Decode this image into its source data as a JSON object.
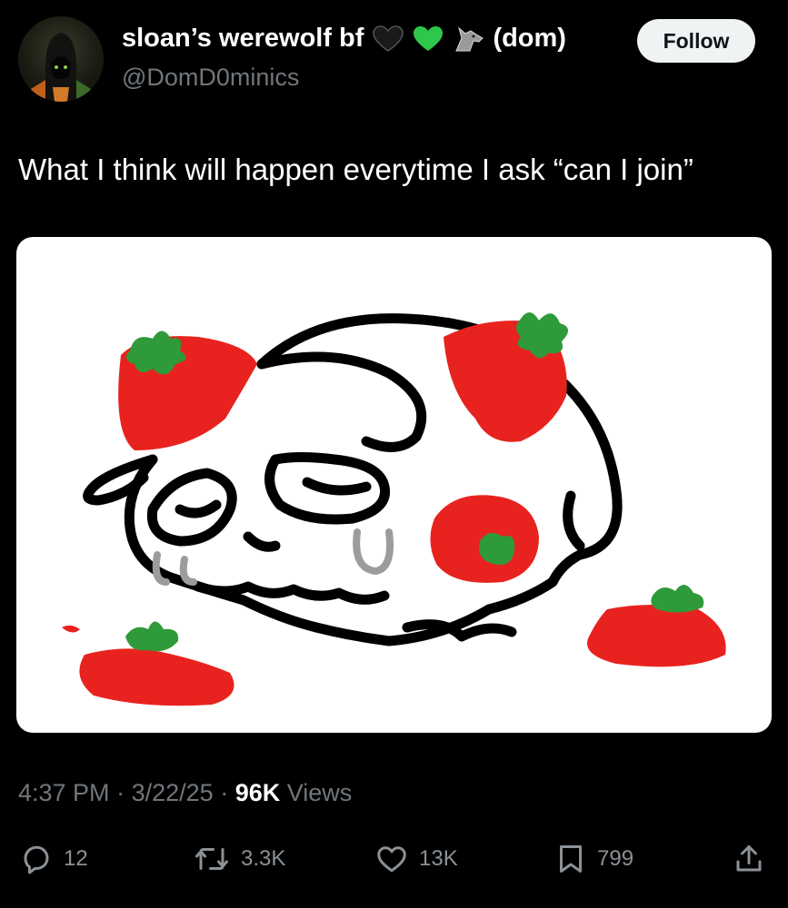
{
  "tweet": {
    "display_name": "sloan’s werewolf bf",
    "name_suffix": "(dom)",
    "handle": "@DomD0minics",
    "follow_label": "Follow",
    "text": "What I think will happen everytime I ask “can I join”",
    "time": "4:37 PM",
    "date": "3/22/25",
    "views_count": "96K",
    "views_label": "Views",
    "separator": "·"
  },
  "actions": {
    "replies": "12",
    "reposts": "3.3K",
    "likes": "13K",
    "bookmarks": "799"
  },
  "colors": {
    "background": "#000000",
    "text_primary": "#ffffff",
    "text_secondary": "#71767b",
    "follow_bg": "#eff3f4",
    "strawberry_red": "#e8231f",
    "leaf_green": "#2e9a3a"
  },
  "icons": [
    "black-heart-icon",
    "green-heart-icon",
    "wolf-icon",
    "reply-icon",
    "repost-icon",
    "like-icon",
    "bookmark-icon",
    "share-icon"
  ]
}
